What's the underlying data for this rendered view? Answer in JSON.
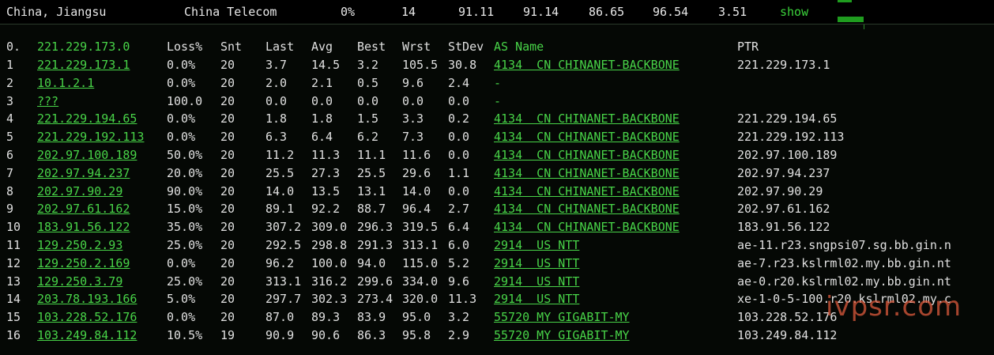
{
  "summary": {
    "location": "China, Jiangsu",
    "isp": "China Telecom",
    "loss": "0%",
    "hops": "14",
    "last": "91.11",
    "avg": "91.14",
    "best": "86.65",
    "worst": "96.54",
    "stdev": "3.51",
    "show_label": "show"
  },
  "table": {
    "headers": {
      "idx": "0.",
      "host": "221.229.173.0",
      "loss": "Loss%",
      "snt": "Snt",
      "last": "Last",
      "avg": "Avg",
      "best": "Best",
      "wrst": "Wrst",
      "stdev": "StDev",
      "as": "AS Name",
      "ptr": "PTR"
    },
    "rows": [
      {
        "idx": "1",
        "host": "221.229.173.1",
        "loss": "0.0%",
        "snt": "20",
        "last": "3.7",
        "avg": "14.5",
        "best": "3.2",
        "wrst": "105.5",
        "stdev": "30.8",
        "as": "4134  CN CHINANET-BACKBONE",
        "ptr": "221.229.173.1"
      },
      {
        "idx": "2",
        "host": "10.1.2.1",
        "loss": "0.0%",
        "snt": "20",
        "last": "2.0",
        "avg": "2.1",
        "best": "0.5",
        "wrst": "9.6",
        "stdev": "2.4",
        "as": "-",
        "ptr": ""
      },
      {
        "idx": "3",
        "host": "???",
        "loss": "100.0",
        "snt": "20",
        "last": "0.0",
        "avg": "0.0",
        "best": "0.0",
        "wrst": "0.0",
        "stdev": "0.0",
        "as": "-",
        "ptr": ""
      },
      {
        "idx": "4",
        "host": "221.229.194.65",
        "loss": "0.0%",
        "snt": "20",
        "last": "1.8",
        "avg": "1.8",
        "best": "1.5",
        "wrst": "3.3",
        "stdev": "0.2",
        "as": "4134  CN CHINANET-BACKBONE",
        "ptr": "221.229.194.65"
      },
      {
        "idx": "5",
        "host": "221.229.192.113",
        "loss": "0.0%",
        "snt": "20",
        "last": "6.3",
        "avg": "6.4",
        "best": "6.2",
        "wrst": "7.3",
        "stdev": "0.0",
        "as": "4134  CN CHINANET-BACKBONE",
        "ptr": "221.229.192.113"
      },
      {
        "idx": "6",
        "host": "202.97.100.189",
        "loss": "50.0%",
        "snt": "20",
        "last": "11.2",
        "avg": "11.3",
        "best": "11.1",
        "wrst": "11.6",
        "stdev": "0.0",
        "as": "4134  CN CHINANET-BACKBONE",
        "ptr": "202.97.100.189"
      },
      {
        "idx": "7",
        "host": "202.97.94.237",
        "loss": "20.0%",
        "snt": "20",
        "last": "25.5",
        "avg": "27.3",
        "best": "25.5",
        "wrst": "29.6",
        "stdev": "1.1",
        "as": "4134  CN CHINANET-BACKBONE",
        "ptr": "202.97.94.237"
      },
      {
        "idx": "8",
        "host": "202.97.90.29",
        "loss": "90.0%",
        "snt": "20",
        "last": "14.0",
        "avg": "13.5",
        "best": "13.1",
        "wrst": "14.0",
        "stdev": "0.0",
        "as": "4134  CN CHINANET-BACKBONE",
        "ptr": "202.97.90.29"
      },
      {
        "idx": "9",
        "host": "202.97.61.162",
        "loss": "15.0%",
        "snt": "20",
        "last": "89.1",
        "avg": "92.2",
        "best": "88.7",
        "wrst": "96.4",
        "stdev": "2.7",
        "as": "4134  CN CHINANET-BACKBONE",
        "ptr": "202.97.61.162"
      },
      {
        "idx": "10",
        "host": "183.91.56.122",
        "loss": "35.0%",
        "snt": "20",
        "last": "307.2",
        "avg": "309.0",
        "best": "296.3",
        "wrst": "319.5",
        "stdev": "6.4",
        "as": "4134  CN CHINANET-BACKBONE",
        "ptr": "183.91.56.122"
      },
      {
        "idx": "11",
        "host": "129.250.2.93",
        "loss": "25.0%",
        "snt": "20",
        "last": "292.5",
        "avg": "298.8",
        "best": "291.3",
        "wrst": "313.1",
        "stdev": "6.0",
        "as": "2914  US NTT",
        "ptr": "ae-11.r23.sngpsi07.sg.bb.gin.n"
      },
      {
        "idx": "12",
        "host": "129.250.2.169",
        "loss": "0.0%",
        "snt": "20",
        "last": "96.2",
        "avg": "100.0",
        "best": "94.0",
        "wrst": "115.0",
        "stdev": "5.2",
        "as": "2914  US NTT",
        "ptr": "ae-7.r23.kslrml02.my.bb.gin.nt"
      },
      {
        "idx": "13",
        "host": "129.250.3.79",
        "loss": "25.0%",
        "snt": "20",
        "last": "313.1",
        "avg": "316.2",
        "best": "299.6",
        "wrst": "334.0",
        "stdev": "9.6",
        "as": "2914  US NTT",
        "ptr": "ae-0.r20.kslrml02.my.bb.gin.nt"
      },
      {
        "idx": "14",
        "host": "203.78.193.166",
        "loss": "5.0%",
        "snt": "20",
        "last": "297.7",
        "avg": "302.3",
        "best": "273.4",
        "wrst": "320.0",
        "stdev": "11.3",
        "as": "2914  US NTT",
        "ptr": "xe-1-0-5-100.r20.kslrml02.my.c"
      },
      {
        "idx": "15",
        "host": "103.228.52.176",
        "loss": "0.0%",
        "snt": "20",
        "last": "87.0",
        "avg": "89.3",
        "best": "83.9",
        "wrst": "95.0",
        "stdev": "3.2",
        "as": "55720 MY GIGABIT-MY",
        "ptr": "103.228.52.176"
      },
      {
        "idx": "16",
        "host": "103.249.84.112",
        "loss": "10.5%",
        "snt": "19",
        "last": "90.9",
        "avg": "90.6",
        "best": "86.3",
        "wrst": "95.8",
        "stdev": "2.9",
        "as": "55720 MY GIGABIT-MY",
        "ptr": "103.249.84.112"
      }
    ]
  },
  "watermark": "ivpsr.com",
  "colors": {
    "accent": "#48d448",
    "background": "#000000",
    "text": "#e0e0e0"
  }
}
